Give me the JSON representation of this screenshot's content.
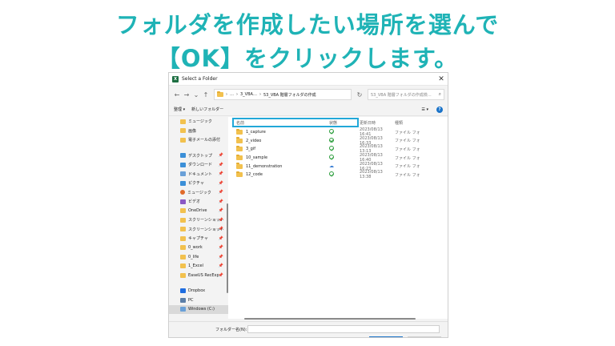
{
  "caption": {
    "line1": "フォルダを作成したい場所を選んで",
    "line2": "【OK】をクリックします。"
  },
  "colors": {
    "accent": "#1fb3b6",
    "highlight": "#22a8d8"
  },
  "dialog": {
    "title": "Select a Folder",
    "close": "✕",
    "nav": {
      "back": "←",
      "forward": "→",
      "down": "⌄",
      "up": "↑",
      "refresh": "↻"
    },
    "address": {
      "sep": "›",
      "seg0": "…",
      "seg1": "3_VBA…",
      "seg2": "53_VBA 階層フォルダの作成"
    },
    "search": {
      "placeholder": "53_VBA 階層フォルダの作成検…",
      "icon": "⌕"
    },
    "toolbar": {
      "organize": "整理 ▾",
      "new_folder": "新しいフォルダー",
      "view": "☰ ▾",
      "help": "?"
    },
    "sidebar": [
      {
        "label": "ミュージック",
        "icon": "y"
      },
      {
        "label": "画像",
        "icon": "y"
      },
      {
        "label": "電子メールの添付",
        "icon": "y"
      },
      {
        "label": "デスクトップ",
        "icon": "b",
        "pin": "📌"
      },
      {
        "label": "ダウンロード",
        "icon": "b",
        "pin": "📌"
      },
      {
        "label": "ドキュメント",
        "icon": "w",
        "pin": "📌"
      },
      {
        "label": "ピクチャ",
        "icon": "b",
        "pin": "📌"
      },
      {
        "label": "ミュージック",
        "icon": "o",
        "pin": "📌"
      },
      {
        "label": "ビデオ",
        "icon": "p",
        "pin": "📌"
      },
      {
        "label": "OneDrive",
        "icon": "y",
        "pin": "📌"
      },
      {
        "label": "スクリーンショット",
        "icon": "y",
        "pin": "📌"
      },
      {
        "label": "スクリーンショット",
        "icon": "y",
        "pin": "📌"
      },
      {
        "label": "キャプチャ",
        "icon": "y",
        "pin": "📌"
      },
      {
        "label": "0_work",
        "icon": "y",
        "pin": "📌"
      },
      {
        "label": "0_life",
        "icon": "y",
        "pin": "📌"
      },
      {
        "label": "1_Excel",
        "icon": "y",
        "pin": "📌"
      },
      {
        "label": "EaseUS RecExp",
        "icon": "y",
        "pin": "📌"
      },
      {
        "label": "Dropbox",
        "icon": "db"
      },
      {
        "label": "PC",
        "icon": "pc"
      },
      {
        "label": "Windows (C:)",
        "icon": "w"
      }
    ],
    "columns": {
      "name": "名前",
      "status": "状態",
      "date": "更新日時",
      "type": "種類"
    },
    "files": [
      {
        "name": "1_capture",
        "status": "synced",
        "date": "2023/08/13 16:41",
        "type": "ファイル フォ"
      },
      {
        "name": "2_video",
        "status": "synced",
        "date": "2023/08/13 16:33",
        "type": "ファイル フォ"
      },
      {
        "name": "3_gif",
        "status": "synced",
        "date": "2023/08/13 13:13",
        "type": "ファイル フォ"
      },
      {
        "name": "10_sample",
        "status": "synced",
        "date": "2023/08/13 16:40",
        "type": "ファイル フォ"
      },
      {
        "name": "11_demonstration",
        "status": "cloud",
        "date": "2023/08/13 16:23",
        "type": "ファイル フォ"
      },
      {
        "name": "12_code",
        "status": "synced",
        "date": "2023/08/13 13:38",
        "type": "ファイル フォ"
      }
    ],
    "footer": {
      "folder_label": "フォルダー名(N):",
      "folder_value": ""
    }
  }
}
